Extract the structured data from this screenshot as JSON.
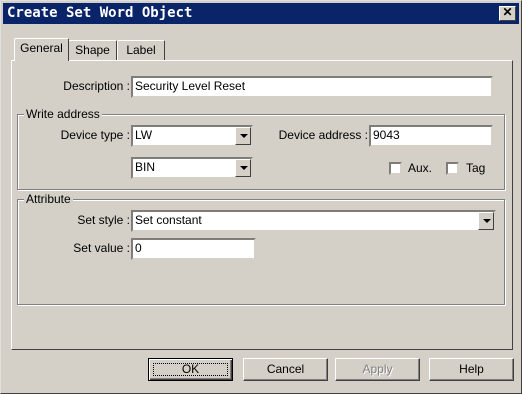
{
  "window": {
    "title": "Create Set Word Object"
  },
  "tabs": [
    {
      "label": "General"
    },
    {
      "label": "Shape"
    },
    {
      "label": "Label"
    }
  ],
  "general": {
    "description_label": "Description :",
    "description_value": "Security Level Reset",
    "write_address": {
      "group_label": "Write address",
      "device_type_label": "Device type :",
      "device_type_value": "LW",
      "format_value": "BIN",
      "device_address_label": "Device address :",
      "device_address_value": "9043",
      "aux_label": "Aux.",
      "aux_checked": false,
      "tag_label": "Tag",
      "tag_checked": false
    },
    "attribute": {
      "group_label": "Attribute",
      "set_style_label": "Set style :",
      "set_style_value": "Set constant",
      "set_value_label": "Set value :",
      "set_value_value": "0"
    }
  },
  "buttons": {
    "ok": "OK",
    "cancel": "Cancel",
    "apply": "Apply",
    "help": "Help"
  }
}
